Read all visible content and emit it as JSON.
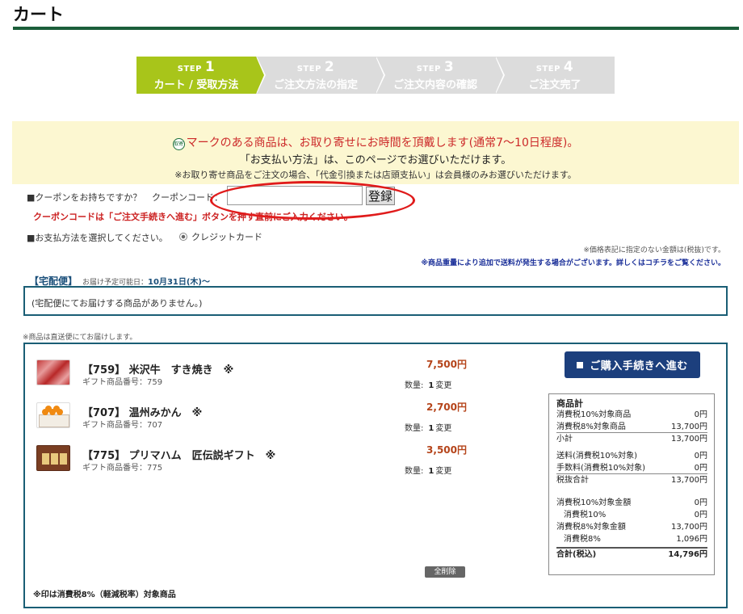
{
  "page": {
    "title": "カート"
  },
  "steps": [
    {
      "prefix": "STEP",
      "num": "1",
      "label": "カート / 受取方法",
      "active": true
    },
    {
      "prefix": "STEP",
      "num": "2",
      "label": "ご注文方法の指定",
      "active": false
    },
    {
      "prefix": "STEP",
      "num": "3",
      "label": "ご注文内容の確認",
      "active": false
    },
    {
      "prefix": "STEP",
      "num": "4",
      "label": "ご注文完了",
      "active": false
    }
  ],
  "notice": {
    "mark": "取寄",
    "line1": "マークのある商品は、お取り寄せにお時間を頂戴します(通常7～10日程度)。",
    "line2": "「お支払い方法」は、このページでお選びいただけます。",
    "line3": "※お取り寄せ商品をご注文の場合、「代金引換または店頭支払い」は会員様のみお選びいただけます。"
  },
  "coupon": {
    "question": "■クーポンをお持ちですか？",
    "field_label": "クーポンコード：",
    "value": "",
    "button": "登録",
    "warning": "クーポンコードは「ご注文手続きへ進む」ボタンを押す直前にご入力ください。"
  },
  "payment": {
    "label": "■お支払方法を選択してください。",
    "option": "クレジットカード"
  },
  "notes": {
    "tax": "※価格表記に指定のない金額は(税抜)です。",
    "shipping": "※商品重量により追加で送料が発生する場合がございます。詳しくはコチラをご覧ください。"
  },
  "takuhaibin": {
    "title": "【宅配便】",
    "date_label": "お届け予定可能日：",
    "date": "10月31日(木)〜",
    "empty": "(宅配便にてお届けする商品がありません。)"
  },
  "direct_note": "※商品は直送便にてお届けします。",
  "items": [
    {
      "name": "【759】 米沢牛　すき焼き　※",
      "code": "ギフト商品番号：759",
      "price": "7,500円",
      "qty_label": "数量:",
      "qty": "1",
      "change": "変更",
      "image": "beef-image"
    },
    {
      "name": "【707】 温州みかん　※",
      "code": "ギフト商品番号：707",
      "price": "2,700円",
      "qty_label": "数量:",
      "qty": "1",
      "change": "変更",
      "image": "mikan-image"
    },
    {
      "name": "【775】 プリマハム　匠伝説ギフト　※",
      "code": "ギフト商品番号：775",
      "price": "3,500円",
      "qty_label": "数量:",
      "qty": "1",
      "change": "変更",
      "image": "ham-image"
    }
  ],
  "proceed_button": "ご購入手続きへ進む",
  "summary": {
    "title": "商品計",
    "rows": [
      {
        "k": "消費税10%対象商品",
        "v": "0円"
      },
      {
        "k": "消費税8%対象商品",
        "v": "13,700円"
      },
      {
        "k": "小計",
        "v": "13,700円"
      },
      {
        "k": "送料(消費税10%対象)",
        "v": "0円"
      },
      {
        "k": "手数料(消費税10%対象)",
        "v": "0円"
      },
      {
        "k": "税抜合計",
        "v": "13,700円"
      },
      {
        "k": "消費税10%対象金額",
        "v": "0円"
      },
      {
        "k": "消費税10%",
        "v": "0円"
      },
      {
        "k": "消費税8%対象金額",
        "v": "13,700円"
      },
      {
        "k": "消費税8%",
        "v": "1,096円"
      },
      {
        "k": "合計(税込)",
        "v": "14,796円"
      }
    ]
  },
  "delete_all": "全削除",
  "footnote": "※印は消費税8%（軽減税率）対象商品",
  "colors": {
    "accent_green": "#a8c51a",
    "brand_dark_green": "#1b5e3a",
    "button_navy": "#1c3f7d",
    "price_red": "#b5441a",
    "highlight_ellipse": "#e01b1b"
  }
}
